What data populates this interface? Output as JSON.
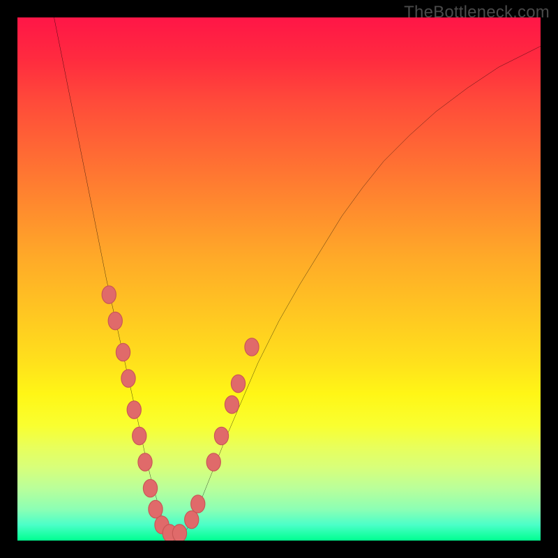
{
  "watermark": "TheBottleneck.com",
  "colors": {
    "frame_bg": "#000000",
    "curve_stroke": "#000000",
    "marker_fill": "#e06a6a",
    "marker_stroke": "#c85555"
  },
  "chart_data": {
    "type": "line",
    "title": "",
    "xlabel": "",
    "ylabel": "",
    "xlim": [
      0,
      100
    ],
    "ylim": [
      0,
      100
    ],
    "note": "Axes are unlabeled in the original image; coordinates below are estimated positions in a 0–100 viewport (origin top-left).",
    "series": [
      {
        "name": "bottleneck-curve",
        "x": [
          7,
          9,
          11,
          13,
          15,
          17,
          19,
          21,
          23,
          24.5,
          26,
          27.5,
          29,
          30.5,
          32,
          34,
          36,
          38,
          40,
          43,
          46,
          50,
          54,
          58,
          62,
          66,
          70,
          75,
          80,
          86,
          92,
          100
        ],
        "values": [
          0,
          10,
          20,
          30,
          40,
          50,
          59,
          68,
          77,
          84,
          90,
          95,
          98,
          99.3,
          98.5,
          95,
          90,
          85,
          80,
          73,
          66,
          58,
          51,
          44.5,
          38,
          32.5,
          27.5,
          22.5,
          18,
          13.5,
          9.5,
          5.5
        ]
      }
    ],
    "markers": [
      {
        "x": 17.5,
        "y": 53
      },
      {
        "x": 18.7,
        "y": 58
      },
      {
        "x": 20.2,
        "y": 64
      },
      {
        "x": 21.2,
        "y": 69
      },
      {
        "x": 22.3,
        "y": 75
      },
      {
        "x": 23.3,
        "y": 80
      },
      {
        "x": 24.4,
        "y": 85
      },
      {
        "x": 25.4,
        "y": 90
      },
      {
        "x": 26.4,
        "y": 94
      },
      {
        "x": 27.6,
        "y": 97
      },
      {
        "x": 29.1,
        "y": 98.6
      },
      {
        "x": 31.0,
        "y": 98.6
      },
      {
        "x": 33.3,
        "y": 96
      },
      {
        "x": 34.5,
        "y": 93
      },
      {
        "x": 37.5,
        "y": 85
      },
      {
        "x": 39.0,
        "y": 80
      },
      {
        "x": 41.0,
        "y": 74
      },
      {
        "x": 42.2,
        "y": 70
      },
      {
        "x": 44.8,
        "y": 63
      }
    ]
  }
}
